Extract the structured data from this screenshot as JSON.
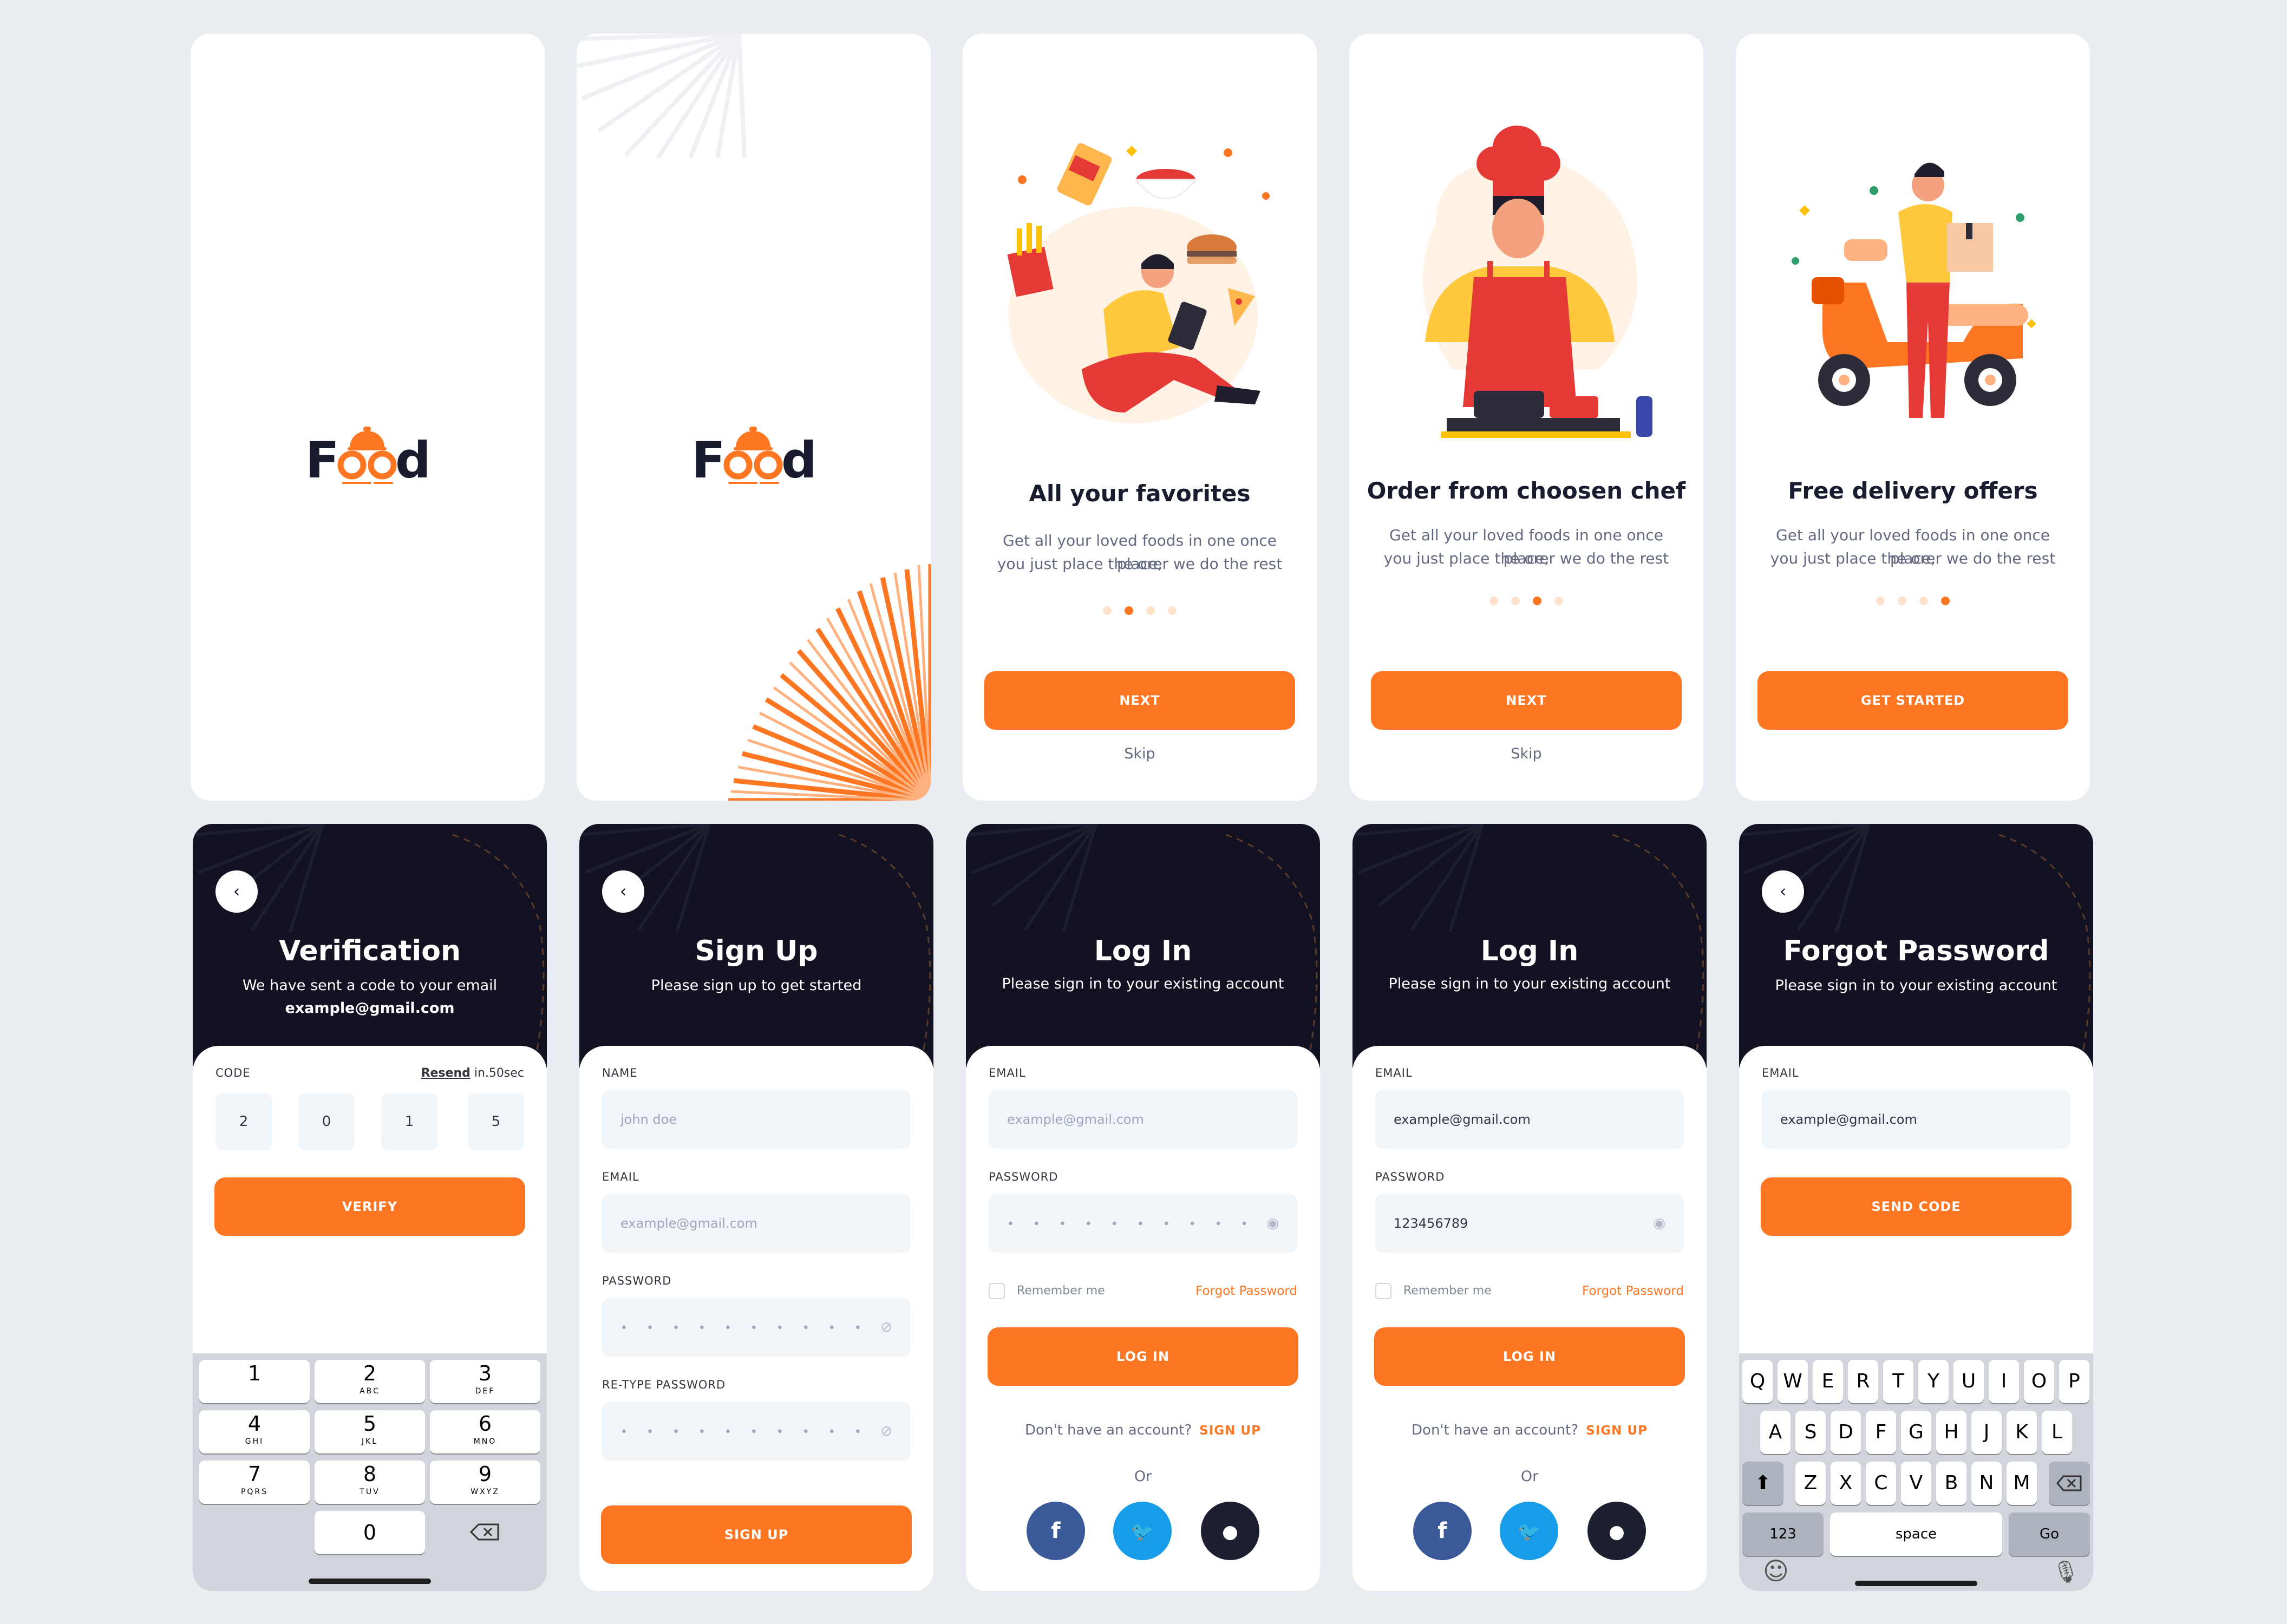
{
  "brand": {
    "logo_text": "Food"
  },
  "colors": {
    "accent": "#FF7622",
    "dark": "#121223",
    "bg": "#E9ECF1"
  },
  "onboarding": [
    {
      "title": "All your favorites",
      "desc1": "Get all your loved foods in one once place,",
      "desc2": "you just place the orer we do the rest",
      "button": "NEXT",
      "skip": "Skip",
      "active_dot": 1
    },
    {
      "title": "Order from choosen chef",
      "desc1": "Get all your loved foods in one once place,",
      "desc2": "you just place the orer we do the rest",
      "button": "NEXT",
      "skip": "Skip",
      "active_dot": 2
    },
    {
      "title": "Free delivery offers",
      "desc1": "Get all your loved foods in one once place,",
      "desc2": "you just place the orer we do the rest",
      "button": "GET STARTED",
      "active_dot": 3
    }
  ],
  "verification": {
    "title": "Verification",
    "subtitle": "We have sent a code to your email",
    "email": "example@gmail.com",
    "code_label": "CODE",
    "resend": "Resend",
    "timer": "in.50sec",
    "digits": [
      "2",
      "0",
      "1",
      "5"
    ],
    "button": "VERIFY",
    "keypad": [
      {
        "n": "1",
        "s": ""
      },
      {
        "n": "2",
        "s": "ABC"
      },
      {
        "n": "3",
        "s": "DEF"
      },
      {
        "n": "4",
        "s": "GHI"
      },
      {
        "n": "5",
        "s": "JKL"
      },
      {
        "n": "6",
        "s": "MNO"
      },
      {
        "n": "7",
        "s": "PQRS"
      },
      {
        "n": "8",
        "s": "TUV"
      },
      {
        "n": "9",
        "s": "WXYZ"
      },
      {
        "n": "0",
        "s": ""
      }
    ]
  },
  "signup": {
    "title": "Sign Up",
    "subtitle": "Please sign up to get started",
    "name_label": "NAME",
    "name_placeholder": "john doe",
    "email_label": "EMAIL",
    "email_placeholder": "example@gmail.com",
    "password_label": "PASSWORD",
    "password_mask": "• • • • • • • • • •",
    "retype_label": "RE-TYPE PASSWORD",
    "retype_mask": "• • • • • • • • • •",
    "button": "SIGN UP"
  },
  "login_empty": {
    "title": "Log In",
    "subtitle": "Please sign in to your existing account",
    "email_label": "EMAIL",
    "email_placeholder": "example@gmail.com",
    "password_label": "PASSWORD",
    "password_mask": "• • • • • • • • • •",
    "remember": "Remember me",
    "forgot": "Forgot Password",
    "button": "LOG IN",
    "no_account": "Don't have an account?",
    "signup": "SIGN UP",
    "or": "Or"
  },
  "login_filled": {
    "title": "Log In",
    "subtitle": "Please sign in to your existing account",
    "email_label": "EMAIL",
    "email_value": "example@gmail.com",
    "password_label": "PASSWORD",
    "password_value": "123456789",
    "remember": "Remember me",
    "forgot": "Forgot Password",
    "button": "LOG IN",
    "no_account": "Don't have an account?",
    "signup": "SIGN UP",
    "or": "Or"
  },
  "forgot": {
    "title": "Forgot Password",
    "subtitle": "Please sign in to your existing account",
    "email_label": "EMAIL",
    "email_value": "example@gmail.com",
    "button": "SEND CODE",
    "row1": [
      "Q",
      "W",
      "E",
      "R",
      "T",
      "Y",
      "U",
      "I",
      "O",
      "P"
    ],
    "row2": [
      "A",
      "S",
      "D",
      "F",
      "G",
      "H",
      "J",
      "K",
      "L"
    ],
    "row3": [
      "Z",
      "X",
      "C",
      "V",
      "B",
      "N",
      "M"
    ],
    "key_123": "123",
    "key_space": "space",
    "key_go": "Go"
  },
  "icons": {
    "back": "chevron-left-icon",
    "eye": "eye-icon",
    "eye_off": "eye-off-icon",
    "facebook": "facebook-icon",
    "twitter": "twitter-icon",
    "apple": "apple-icon"
  }
}
